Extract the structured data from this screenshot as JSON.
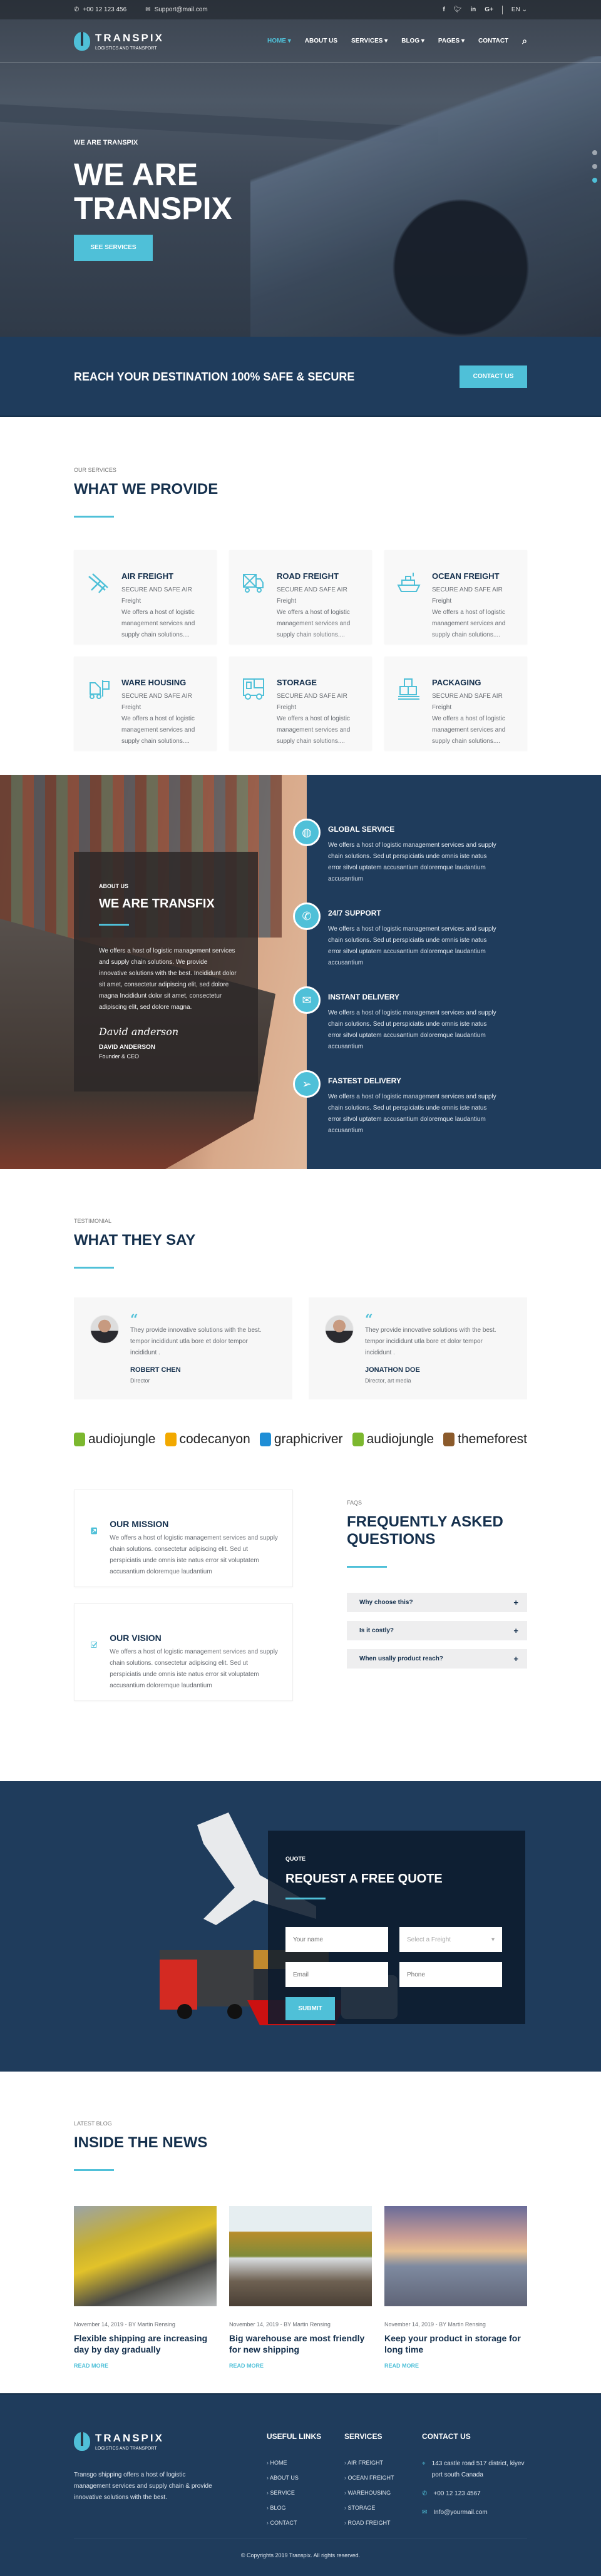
{
  "topbar": {
    "phone": "+00 12 123 456",
    "email": "Support@mail.com",
    "social": [
      "facebook-icon",
      "twitter-icon",
      "linkedin-icon",
      "google-plus-icon"
    ],
    "language": "EN"
  },
  "brand": {
    "name": "TRANSPIX",
    "tagline": "LOGISTICS AND TRANSPORT"
  },
  "nav": {
    "items": [
      {
        "label": "HOME",
        "dropdown": true,
        "active": true
      },
      {
        "label": "ABOUT US",
        "dropdown": false
      },
      {
        "label": "SERVICES",
        "dropdown": true
      },
      {
        "label": "BLOG",
        "dropdown": true
      },
      {
        "label": "PAGES",
        "dropdown": true
      },
      {
        "label": "CONTACT",
        "dropdown": false
      }
    ]
  },
  "hero": {
    "kicker": "WE ARE TRANSPIX",
    "title": "WE ARE TRANSPIX",
    "button": "SEE SERVICES",
    "slides": 3,
    "active_slide": 3
  },
  "banner": {
    "text": "REACH YOUR DESTINATION 100% SAFE & SECURE",
    "button": "CONTACT US"
  },
  "services": {
    "kicker": "OUR SERVICES",
    "title": "WHAT WE PROVIDE",
    "items": [
      {
        "title": "AIR FREIGHT",
        "subtitle": "SECURE AND SAFE AIR Freight",
        "text": "We offers a host of logistic management services and supply chain solutions....",
        "icon": "airplane-icon"
      },
      {
        "title": "ROAD FREIGHT",
        "subtitle": "SECURE AND SAFE AIR Freight",
        "text": "We offers a host of logistic management services and supply chain solutions....",
        "icon": "truck-icon"
      },
      {
        "title": "OCEAN FREIGHT",
        "subtitle": "SECURE AND SAFE AIR Freight",
        "text": "We offers a host of logistic management services and supply chain solutions....",
        "icon": "ship-icon"
      },
      {
        "title": "WARE HOUSING",
        "subtitle": "SECURE AND SAFE AIR Freight",
        "text": "We offers a host of logistic management services and supply chain solutions....",
        "icon": "forklift-icon"
      },
      {
        "title": "STORAGE",
        "subtitle": "SECURE AND SAFE AIR Freight",
        "text": "We offers a host of logistic management services and supply chain solutions....",
        "icon": "storage-truck-icon"
      },
      {
        "title": "PACKAGING",
        "subtitle": "SECURE AND SAFE AIR Freight",
        "text": "We offers a host of logistic management services and supply chain solutions....",
        "icon": "boxes-icon"
      }
    ]
  },
  "about": {
    "kicker": "ABOUT US",
    "title": "WE ARE TRANSFIX",
    "text": "We offers a host of logistic management services and supply chain solutions. We provide innovative solutions with the best. Incididunt dolor sit amet, consectetur adipiscing elit, sed dolore magna Incididunt dolor sit amet, consectetur adipiscing elit, sed dolore magna.",
    "signature": "David anderson",
    "name": "DAVID ANDERSON",
    "role": "Founder & CEO",
    "features": [
      {
        "title": "GLOBAL SERVICE",
        "icon": "globe-icon",
        "text": "We offers a host of logistic management services and supply chain solutions. Sed ut perspiciatis unde omnis iste natus error sitvol uptatem accusantium doloremque laudantium accusantium"
      },
      {
        "title": "24/7 SUPPORT",
        "icon": "phone-24-icon",
        "text": "We offers a host of logistic management services and supply chain solutions. Sed ut perspiciatis unde omnis iste natus error sitvol uptatem accusantium doloremque laudantium accusantium"
      },
      {
        "title": "INSTANT DELIVERY",
        "icon": "envelope-icon",
        "text": "We offers a host of logistic management services and supply chain solutions. Sed ut perspiciatis unde omnis iste natus error sitvol uptatem accusantium doloremque laudantium accusantium"
      },
      {
        "title": "FASTEST DELIVERY",
        "icon": "paper-plane-icon",
        "text": "We offers a host of logistic management services and supply chain solutions. Sed ut perspiciatis unde omnis iste natus error sitvol uptatem accusantium doloremque laudantium accusantium"
      }
    ]
  },
  "testimonials": {
    "kicker": "TESTIMONIAL",
    "title": "WHAT THEY SAY",
    "items": [
      {
        "text": "They provide innovative solutions with the best. tempor incididunt utla bore et dolor tempor incididunt .",
        "name": "ROBERT CHEN",
        "role": "Director"
      },
      {
        "text": "They provide innovative solutions with the best. tempor incididunt utla bore et dolor tempor incididunt .",
        "name": "JONATHON DOE",
        "role": "Director, art media"
      }
    ],
    "logos": [
      {
        "name": "audiojungle",
        "color": "#7cb82f"
      },
      {
        "name": "codecanyon",
        "color": "#f2a900"
      },
      {
        "name": "graphicriver",
        "color": "#1f8ed6"
      },
      {
        "name": "audiojungle",
        "color": "#7cb82f"
      },
      {
        "name": "themeforest",
        "color": "#8b5a2b"
      }
    ]
  },
  "mission": [
    {
      "title": "OUR MISSION",
      "icon": "arrow-up-right-icon",
      "text": "We offers a host of logistic management services and supply chain solutions. consectetur adipiscing elit. Sed ut perspiciatis unde omnis iste natus error sit voluptatem accusantium doloremque laudantium"
    },
    {
      "title": "OUR VISION",
      "icon": "checkbox-icon",
      "text": "We offers a host of logistic management services and supply chain solutions. consectetur adipiscing elit. Sed ut perspiciatis unde omnis iste natus error sit voluptatem accusantium doloremque laudantium"
    }
  ],
  "faq": {
    "kicker": "FAQS",
    "title": "FREQUENTLY ASKED QUESTIONS",
    "items": [
      "Why choose this?",
      "Is it costly?",
      "When usally product reach?"
    ]
  },
  "quote": {
    "kicker": "QUOTE",
    "title": "REQUEST A FREE QUOTE",
    "name_placeholder": "Your name",
    "freight_placeholder": "Select a Freight",
    "email_placeholder": "Email",
    "phone_placeholder": "Phone",
    "submit": "SUBMIT"
  },
  "news": {
    "kicker": "LATEST BLOG",
    "title": "INSIDE THE NEWS",
    "items": [
      {
        "date": "November 14, 2019",
        "author": "BY Martin Rensing",
        "title": "Flexible shipping are increasing day by day gradually",
        "more": "READ MORE"
      },
      {
        "date": "November 14, 2019",
        "author": "BY Martin Rensing",
        "title": "Big warehouse are most friendly for new shipping",
        "more": "READ MORE"
      },
      {
        "date": "November 14, 2019",
        "author": "BY Martin Rensing",
        "title": "Keep your product in storage for long time",
        "more": "READ MORE"
      }
    ]
  },
  "footer": {
    "about": "Transgo shipping offers a host of logistic management services and supply chain & provide innovative solutions with the best.",
    "links_title": "USEFUL LINKS",
    "links": [
      "HOME",
      "ABOUT US",
      "SERVICE",
      "BLOG",
      "CONTACT"
    ],
    "services_title": "SERVICES",
    "services": [
      "AIR FREIGHT",
      "OCEAN FREIGHT",
      "WAREHOUSING",
      "STORAGE",
      "ROAD FREIGHT"
    ],
    "contact_title": "CONTACT US",
    "address": "143 castle road 517 district, kiyev port south Canada",
    "phone": "+00 12 123 4567",
    "email": "Info@yourmail.com",
    "copyright": "© Copyrights 2019 Transpix. All rights reserved."
  },
  "colors": {
    "accent": "#4fc0d8",
    "navy": "#1f3c5c",
    "heading": "#15304d"
  }
}
